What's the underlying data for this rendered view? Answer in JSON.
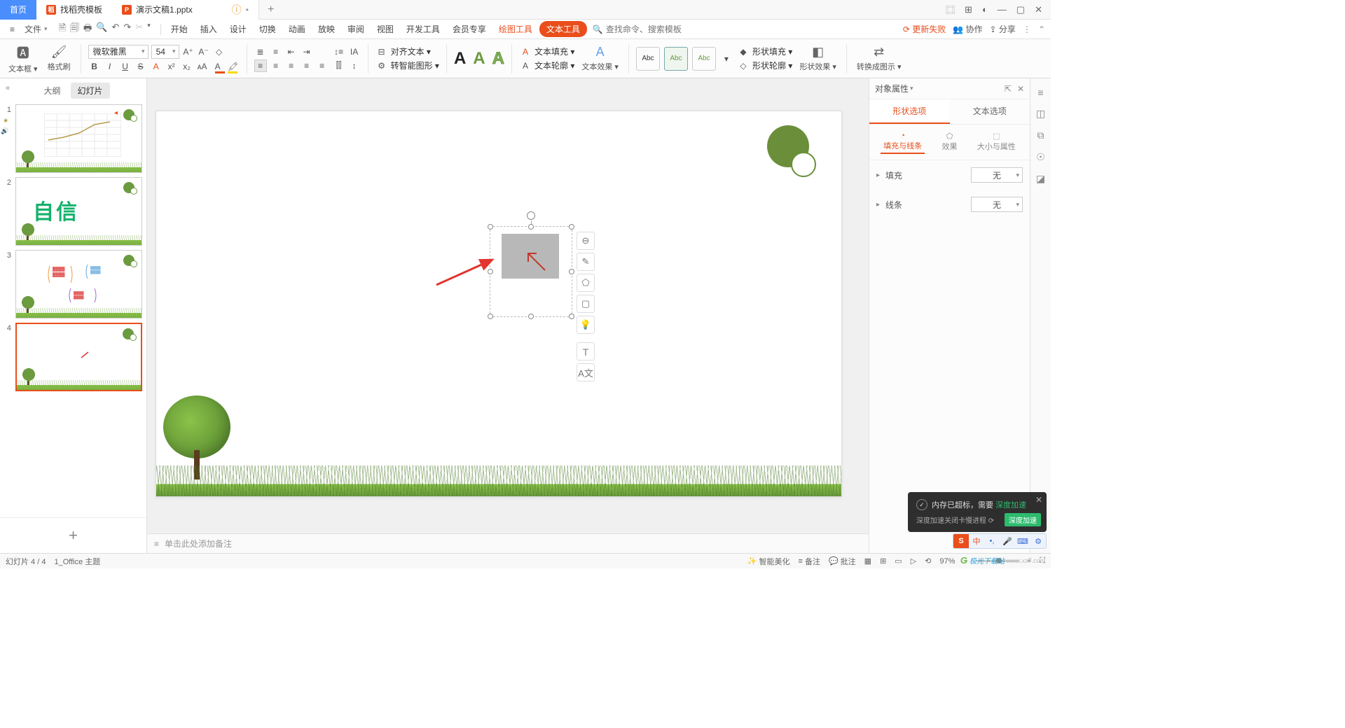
{
  "titlebar": {
    "home": "首页",
    "template_tab": "找稻壳模板",
    "doc_tab": "演示文稿1.pptx"
  },
  "menubar": {
    "file": "文件",
    "tabs": [
      "开始",
      "插入",
      "设计",
      "切换",
      "动画",
      "放映",
      "审阅",
      "视图",
      "开发工具",
      "会员专享"
    ],
    "draw_tool": "绘图工具",
    "text_tool": "文本工具",
    "search_placeholder": "查找命令、搜索模板",
    "update_fail": "更新失败",
    "coop": "协作",
    "share": "分享"
  },
  "ribbon": {
    "textbox": "文本框",
    "format_painter": "格式刷",
    "font_name": "微软雅黑",
    "font_size": "54",
    "align_text": "对齐文本",
    "smart_graphic": "转智能图形",
    "text_fill": "文本填充",
    "text_outline": "文本轮廓",
    "text_effect": "文本效果",
    "abc": "Abc",
    "shape_fill": "形状填充",
    "shape_outline": "形状轮廓",
    "shape_effect": "形状效果",
    "convert_graphic": "转换成图示"
  },
  "thumbs": {
    "outline": "大纲",
    "slides": "幻灯片",
    "slide2_text": "自信"
  },
  "notes": {
    "placeholder": "单击此处添加备注"
  },
  "props": {
    "title": "对象属性",
    "tab_shape": "形状选项",
    "tab_text": "文本选项",
    "sub_fill": "填充与线条",
    "sub_effect": "效果",
    "sub_size": "大小与属性",
    "row_fill": "填充",
    "row_line": "线条",
    "value_none": "无"
  },
  "status": {
    "slide_pos": "幻灯片 4 / 4",
    "theme": "1_Office 主题",
    "beautify": "智能美化",
    "notes_btn": "备注",
    "comment_btn": "批注",
    "zoom": "97%"
  },
  "popup": {
    "line1a": "内存已超标，需要",
    "line1b": "深度加速",
    "line2": "深度加速关闭卡慢进程",
    "btn": "深度加速"
  },
  "ime": {
    "zh": "中"
  },
  "watermark": {
    "name": "极光下载站",
    "url": "www.xz7.com"
  }
}
